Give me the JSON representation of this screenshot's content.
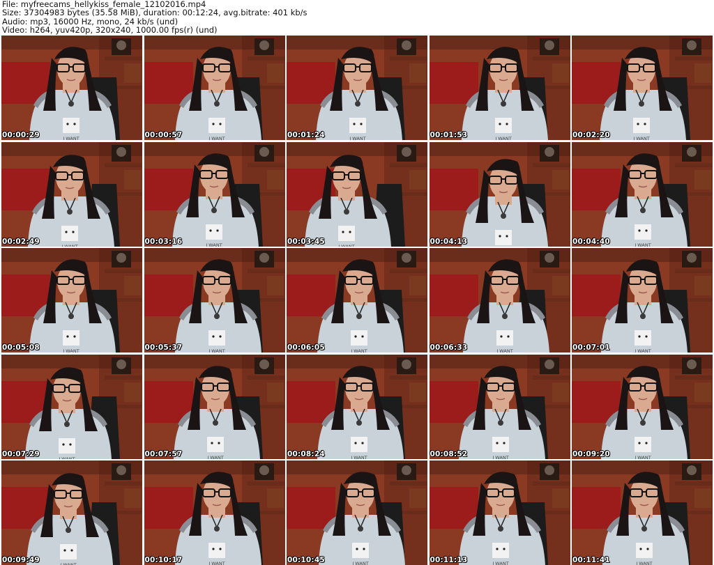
{
  "header": {
    "file": "File: myfreecams_hellykiss_female_12102016.mp4",
    "size": "Size: 37304983 bytes (35.58 MiB), duration: 00:12:24, avg.bitrate: 401 kb/s",
    "audio": "Audio: mp3, 16000 Hz, mono, 24 kb/s (und)",
    "video": "Video: h264, yuv420p, 320x240, 1000.00 fps(r) (und)"
  },
  "thumbnails": [
    "00:00:29",
    "00:00:57",
    "00:01:24",
    "00:01:53",
    "00:02:20",
    "00:02:49",
    "00:03:16",
    "00:03:45",
    "00:04:13",
    "00:04:40",
    "00:05:08",
    "00:05:37",
    "00:06:05",
    "00:06:33",
    "00:07:01",
    "00:07:29",
    "00:07:57",
    "00:08:24",
    "00:08:52",
    "00:09:20",
    "00:09:49",
    "00:10:17",
    "00:10:45",
    "00:11:13",
    "00:11:41"
  ],
  "shirt_text": "I WANT",
  "colors": {
    "wall": "#8a3a22",
    "wall_dark": "#4a1d14",
    "sofa": "#9c1b1b",
    "shirt": "#c8d2d8",
    "hair": "#1a1414",
    "skin": "#d9a990",
    "chair": "#1c1c1c",
    "shelf": "#6a2c1a"
  }
}
